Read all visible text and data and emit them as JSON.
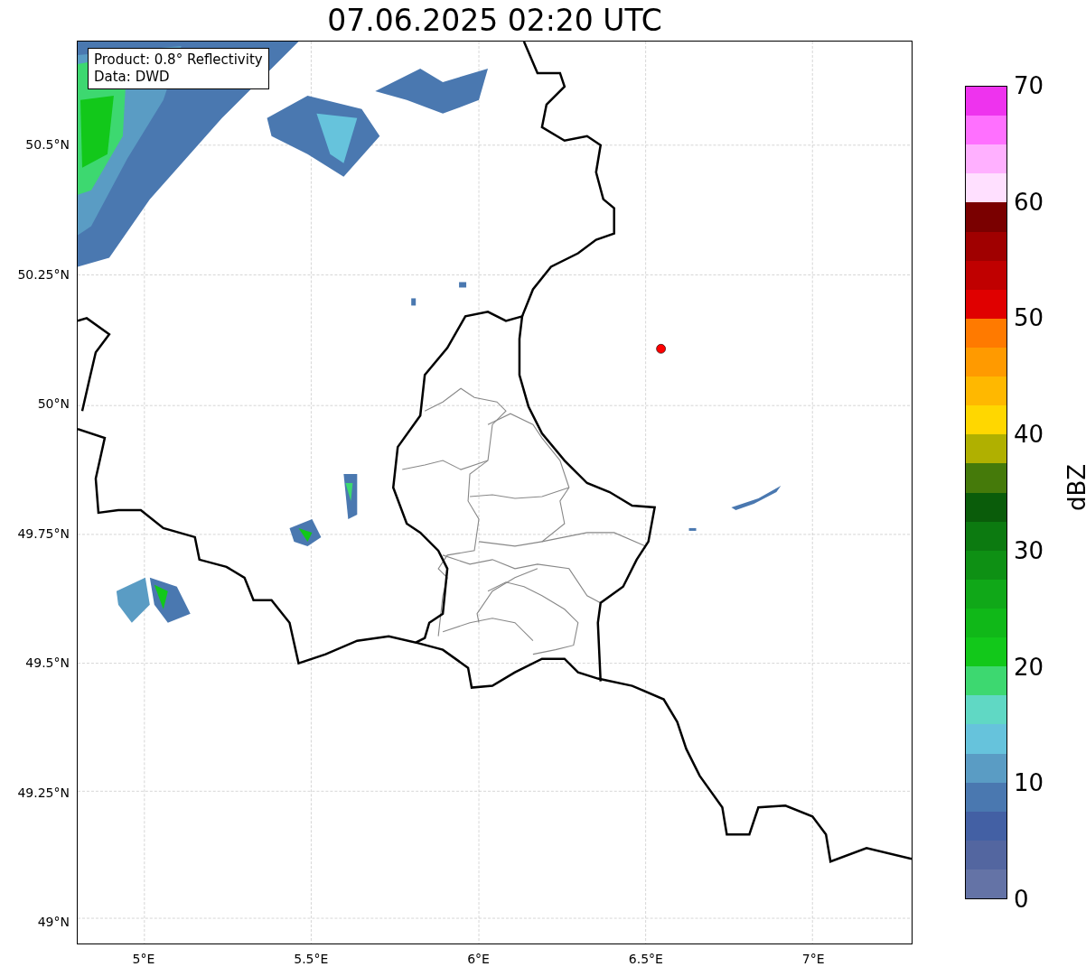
{
  "title": "07.06.2025 02:20 UTC",
  "legend": [
    "Product: 0.8° Reflectivity",
    "Data: DWD"
  ],
  "lat_labels": [
    "50.5°N",
    "50.25°N",
    "50°N",
    "49.75°N",
    "49.5°N",
    "49.25°N",
    "49°N"
  ],
  "lon_labels": [
    "5°E",
    "5.5°E",
    "6°E",
    "6.5°E",
    "7°E"
  ],
  "colorbar": {
    "label": "dBZ",
    "ticks": [
      "70",
      "60",
      "50",
      "40",
      "30",
      "20",
      "10",
      "0"
    ],
    "bands": [
      {
        "color": "#ee33ee"
      },
      {
        "color": "#ff70ff"
      },
      {
        "color": "#ffb0ff"
      },
      {
        "color": "#ffe0ff"
      },
      {
        "color": "#7a0000"
      },
      {
        "color": "#a00000"
      },
      {
        "color": "#c00000"
      },
      {
        "color": "#e00000"
      },
      {
        "color": "#ff7a00"
      },
      {
        "color": "#ff9a00"
      },
      {
        "color": "#ffb800"
      },
      {
        "color": "#ffd700"
      },
      {
        "color": "#b0b000"
      },
      {
        "color": "#457a0a"
      },
      {
        "color": "#0a5c0a"
      },
      {
        "color": "#0c7a10"
      },
      {
        "color": "#0e9014"
      },
      {
        "color": "#10a818"
      },
      {
        "color": "#10b818"
      },
      {
        "color": "#12c81a"
      },
      {
        "color": "#3dd870"
      },
      {
        "color": "#60d8c4"
      },
      {
        "color": "#66c3dc"
      },
      {
        "color": "#5a9cc4"
      },
      {
        "color": "#4a78b0"
      },
      {
        "color": "#4360a4"
      },
      {
        "color": "#5366a0"
      },
      {
        "color": "#6473a6"
      }
    ]
  }
}
